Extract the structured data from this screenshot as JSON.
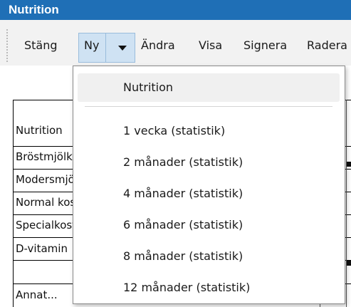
{
  "window": {
    "title": "Nutrition"
  },
  "toolbar": {
    "close_label": "Stäng",
    "new_label": "Ny",
    "edit_label": "Ändra",
    "view_label": "Visa",
    "sign_label": "Signera",
    "delete_label": "Radera"
  },
  "dropdown": {
    "items": [
      {
        "label": "Nutrition"
      },
      {
        "label": "1 vecka (statistik)"
      },
      {
        "label": "2 månader (statistik)"
      },
      {
        "label": "4 månader (statistik)"
      },
      {
        "label": "6 månader (statistik)"
      },
      {
        "label": "8 månader (statistik)"
      },
      {
        "label": "12 månader (statistik)"
      }
    ]
  },
  "table": {
    "rows": [
      {
        "label": "Nutrition"
      },
      {
        "label": "Bröstmjölk"
      },
      {
        "label": "Modersmjölksersättning"
      },
      {
        "label": "Normal kost"
      },
      {
        "label": "Specialkost"
      },
      {
        "label": "D-vitamin"
      },
      {
        "label": "Annat..."
      }
    ]
  }
}
